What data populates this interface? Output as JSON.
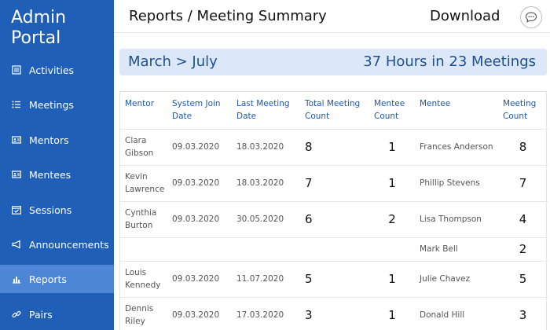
{
  "sidebar": {
    "brand_line1": "Admin",
    "brand_line2": "Portal",
    "items": [
      {
        "label": "Activities",
        "icon": "list-box-icon"
      },
      {
        "label": "Meetings",
        "icon": "bullet-list-icon"
      },
      {
        "label": "Mentors",
        "icon": "id-card-icon"
      },
      {
        "label": "Mentees",
        "icon": "id-card-icon"
      },
      {
        "label": "Sessions",
        "icon": "calendar-check-icon"
      },
      {
        "label": "Announcements",
        "icon": "megaphone-icon"
      },
      {
        "label": "Reports",
        "icon": "bar-chart-icon"
      },
      {
        "label": "Pairs",
        "icon": "link-icon"
      }
    ],
    "active_item": "Reports"
  },
  "header": {
    "title": "Reports / Meeting Summary",
    "download_label": "Download",
    "chat_icon": "chat-bubble-icon"
  },
  "banner": {
    "range": "March > July",
    "summary": "37 Hours in 23 Meetings"
  },
  "table": {
    "columns": [
      "Mentor",
      "System Join Date",
      "Last Meeting Date",
      "Total Meeting Count",
      "Mentee Count",
      "Mentee",
      "Meeting Count"
    ],
    "rows": [
      {
        "mentor": "Clara Gibson",
        "join": "09.03.2020",
        "last": "18.03.2020",
        "total": "8",
        "mentee_count": "1",
        "mentee": "Frances Anderson",
        "meeting_count": "8"
      },
      {
        "mentor": "Kevin Lawrence",
        "join": "09.03.2020",
        "last": "18.03.2020",
        "total": "7",
        "mentee_count": "1",
        "mentee": "Phillip Stevens",
        "meeting_count": "7"
      },
      {
        "mentor": "Cynthia Burton",
        "join": "09.03.2020",
        "last": "30.05.2020",
        "total": "6",
        "mentee_count": "2",
        "mentee": "Lisa Thompson",
        "meeting_count": "4"
      },
      {
        "mentor": "",
        "join": "",
        "last": "",
        "total": "",
        "mentee_count": "",
        "mentee": "Mark Bell",
        "meeting_count": "2"
      },
      {
        "mentor": "Louis Kennedy",
        "join": "09.03.2020",
        "last": "11.07.2020",
        "total": "5",
        "mentee_count": "1",
        "mentee": "Julie Chavez",
        "meeting_count": "5"
      },
      {
        "mentor": "Dennis Riley",
        "join": "09.03.2020",
        "last": "17.03.2020",
        "total": "3",
        "mentee_count": "1",
        "mentee": "Donald Hill",
        "meeting_count": "3"
      }
    ]
  },
  "colors": {
    "sidebar_bg": "#1f5fb8",
    "sidebar_active": "#4c86d4",
    "banner_bg": "#dce8f8",
    "accent_text": "#1d4f95",
    "header_text": "#1e56b0"
  }
}
